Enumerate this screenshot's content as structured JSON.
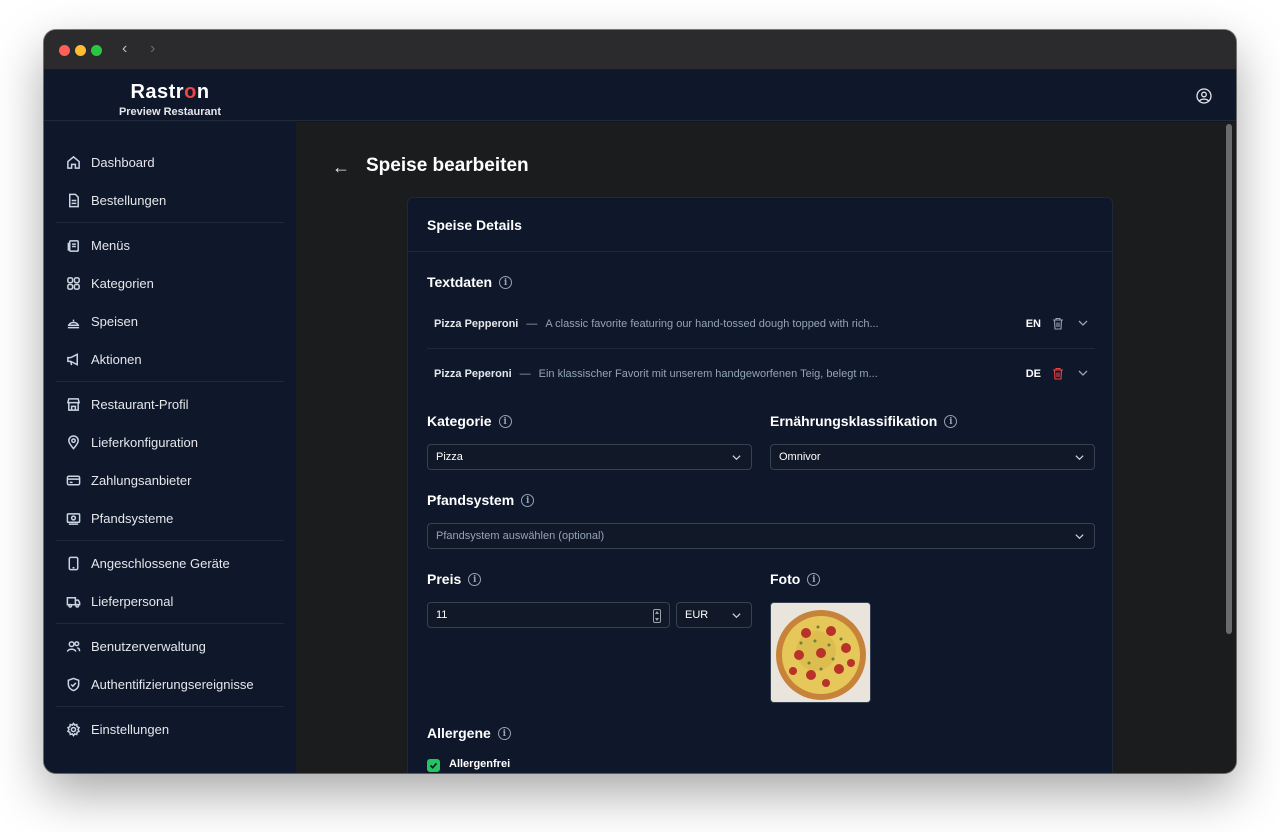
{
  "app": {
    "logo_text": "Rastron",
    "restaurant_name": "Preview Restaurant"
  },
  "sidebar": {
    "items": [
      {
        "label": "Dashboard",
        "icon": "home-icon"
      },
      {
        "label": "Bestellungen",
        "icon": "document-icon"
      },
      {
        "label": "Menüs",
        "icon": "menus-icon"
      },
      {
        "label": "Kategorien",
        "icon": "grid-icon"
      },
      {
        "label": "Speisen",
        "icon": "dish-icon"
      },
      {
        "label": "Aktionen",
        "icon": "megaphone-icon"
      },
      {
        "label": "Restaurant-Profil",
        "icon": "store-icon"
      },
      {
        "label": "Lieferkonfiguration",
        "icon": "map-pin-icon"
      },
      {
        "label": "Zahlungsanbieter",
        "icon": "credit-card-icon"
      },
      {
        "label": "Pfandsysteme",
        "icon": "deposit-icon"
      },
      {
        "label": "Angeschlossene Geräte",
        "icon": "tablet-icon"
      },
      {
        "label": "Lieferpersonal",
        "icon": "truck-icon"
      },
      {
        "label": "Benutzerverwaltung",
        "icon": "users-icon"
      },
      {
        "label": "Authentifizierungsereignisse",
        "icon": "shield-icon"
      },
      {
        "label": "Einstellungen",
        "icon": "gear-icon"
      }
    ]
  },
  "page": {
    "title": "Speise bearbeiten"
  },
  "card": {
    "title": "Speise Details",
    "textdaten": {
      "label": "Textdaten",
      "rows": [
        {
          "name": "Pizza Pepperoni",
          "dash": "—",
          "description": "A classic favorite featuring our hand-tossed dough topped with rich...",
          "lang": "EN",
          "trash_color": "#94a3b8"
        },
        {
          "name": "Pizza Peperoni",
          "dash": "—",
          "description": "Ein klassischer Favorit mit unserem handgeworfenen Teig, belegt m...",
          "lang": "DE",
          "trash_color": "#ef4444"
        }
      ]
    },
    "kategorie": {
      "label": "Kategorie",
      "value": "Pizza"
    },
    "ernaehrung": {
      "label": "Ernährungsklassifikation",
      "value": "Omnivor"
    },
    "pfandsystem": {
      "label": "Pfandsystem",
      "placeholder": "Pfandsystem auswählen (optional)"
    },
    "preis": {
      "label": "Preis",
      "value": "11",
      "currency": "EUR"
    },
    "foto": {
      "label": "Foto"
    },
    "allergene": {
      "label": "Allergene",
      "checkbox_label": "Allergenfrei",
      "checked": true
    }
  },
  "colors": {
    "accent_green": "#22c55e",
    "danger_red": "#ef4444",
    "bg_dark": "#0f172a"
  }
}
